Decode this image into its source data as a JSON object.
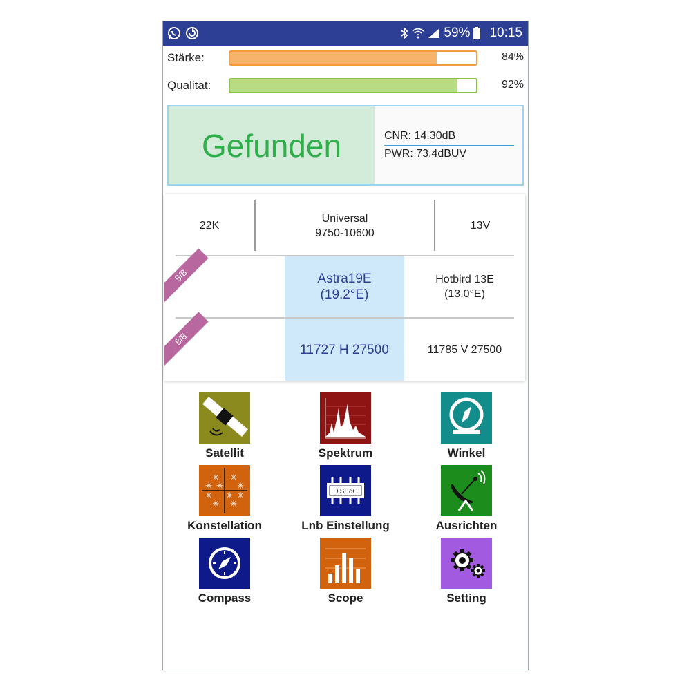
{
  "status_bar": {
    "battery": "59%",
    "time": "10:15",
    "left_icons": [
      "whatsapp-icon",
      "sync-icon"
    ],
    "right_icons": [
      "bluetooth-icon",
      "wifi-icon",
      "signal-icon",
      "battery-icon"
    ]
  },
  "meters": {
    "strength": {
      "label": "Stärke:",
      "value_text": "84%",
      "value": 0.84,
      "color": "#f7b26b",
      "border": "#f29c3f"
    },
    "quality": {
      "label": "Qualität:",
      "value_text": "92%",
      "value": 0.92,
      "color": "#b8dc84",
      "border": "#8cc24a"
    }
  },
  "status_panel": {
    "found_text": "Gefunden",
    "cnr": "CNR: 14.30dB",
    "pwr": "PWR: 73.4dBUV"
  },
  "lnb": {
    "tone": "22K",
    "type": "Universal",
    "range": "9750-10600",
    "voltage": "13V"
  },
  "satellites": {
    "badge": "5/8",
    "selected_name": "Astra19E",
    "selected_pos": "(19.2°E)",
    "other_name": "Hotbird 13E",
    "other_pos": "(13.0°E)"
  },
  "transponders": {
    "badge": "8/8",
    "selected": "11727 H 27500",
    "other": "11785 V 27500"
  },
  "menu": [
    {
      "label": "Satellit",
      "icon": "satellite-icon",
      "color": "#8a8a1e"
    },
    {
      "label": "Spektrum",
      "icon": "spectrum-icon",
      "color": "#8e1414"
    },
    {
      "label": "Winkel",
      "icon": "angle-dial-icon",
      "color": "#138c8c"
    },
    {
      "label": "Konstellation",
      "icon": "constellation-icon",
      "color": "#d1630f"
    },
    {
      "label": "Lnb Einstellung",
      "icon": "diseqc-icon",
      "color": "#0f1a8a"
    },
    {
      "label": "Ausrichten",
      "icon": "dish-align-icon",
      "color": "#1c8c1c"
    },
    {
      "label": "Compass",
      "icon": "compass-icon",
      "color": "#0f1a8a"
    },
    {
      "label": "Scope",
      "icon": "scope-bars-icon",
      "color": "#d1630f"
    },
    {
      "label": "Setting",
      "icon": "gears-icon",
      "color": "#a25be0"
    }
  ],
  "diseqc_label": "DiSEqC"
}
